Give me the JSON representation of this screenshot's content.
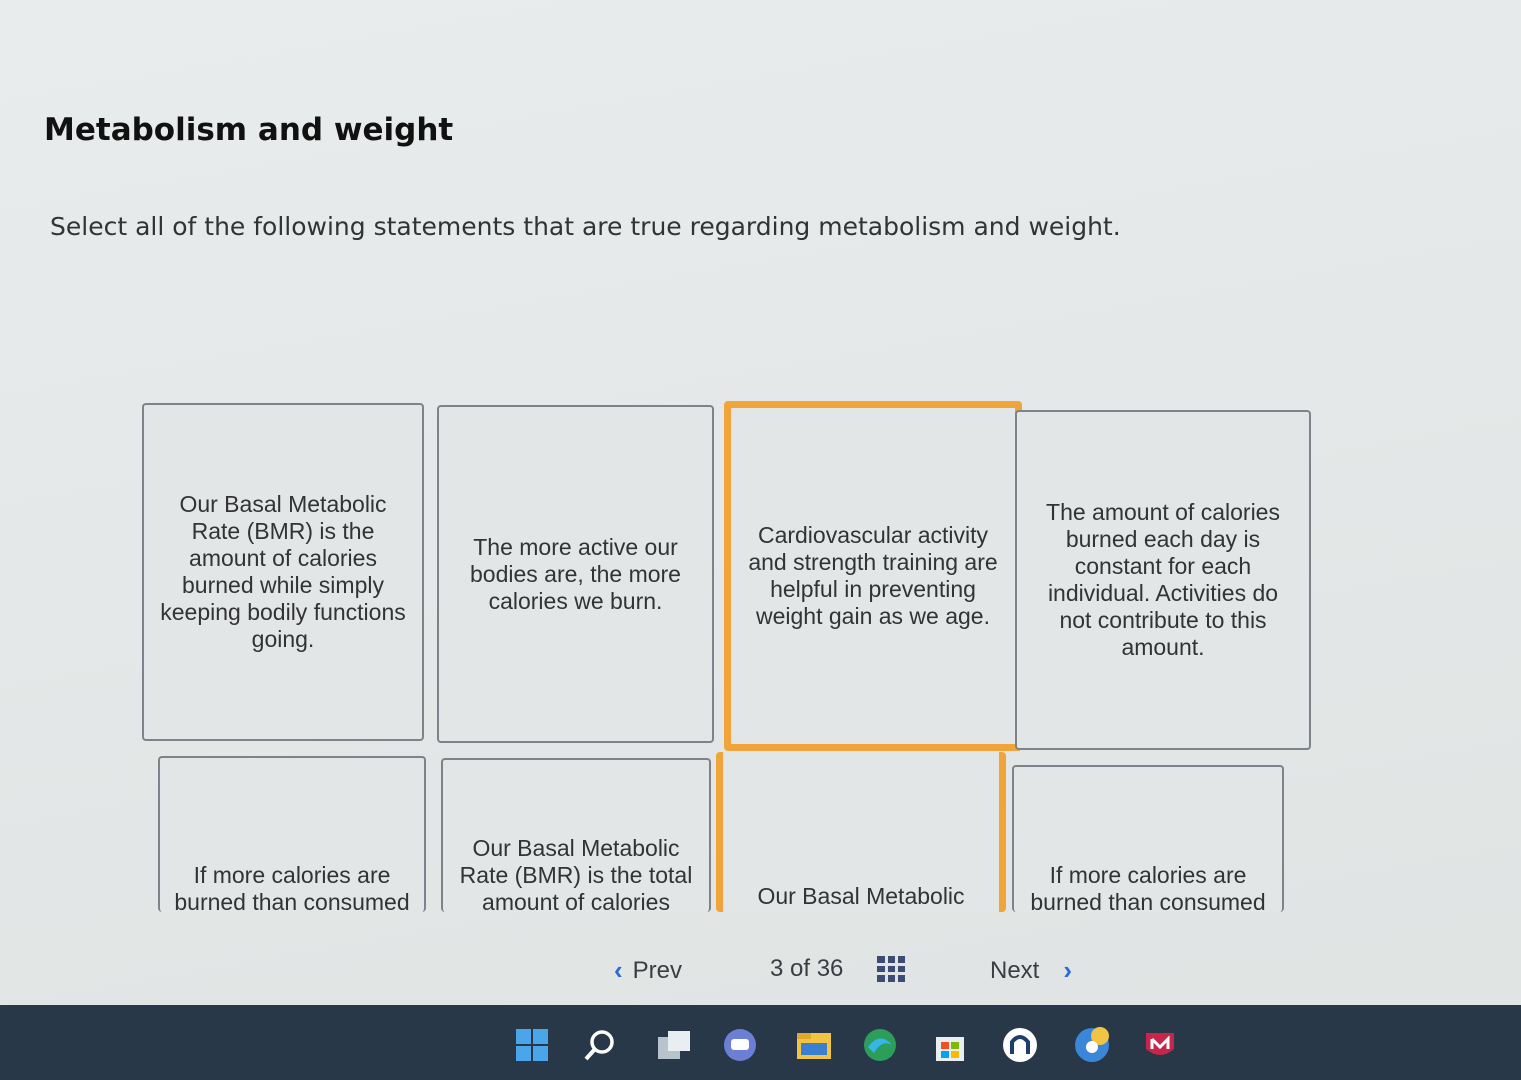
{
  "title": "Metabolism and weight",
  "prompt": "Select all of the following statements that are true regarding metabolism and weight.",
  "cards": [
    {
      "text": "Our Basal Metabolic Rate (BMR) is the amount of calories burned while simply keeping bodily functions going.",
      "selected": false
    },
    {
      "text": "The more active our bodies are, the more calories we burn.",
      "selected": false
    },
    {
      "text": "Cardiovascular activity and strength training are helpful in preventing weight gain as we age.",
      "selected": true
    },
    {
      "text": "The amount of calories burned each day is constant for each individual. Activities do not contribute to this amount.",
      "selected": false
    },
    {
      "text": "If more calories are burned than consumed",
      "selected": false
    },
    {
      "text": "Our Basal Metabolic Rate (BMR) is the total amount of calories",
      "selected": false
    },
    {
      "text": "Our Basal Metabolic",
      "selected": true
    },
    {
      "text": "If more calories are burned than consumed",
      "selected": false
    }
  ],
  "pager": {
    "prev": "Prev",
    "position": "3 of 36",
    "next": "Next"
  },
  "taskbar": {
    "icons": [
      "windows-start-icon",
      "search-icon",
      "task-view-icon",
      "chat-icon",
      "file-explorer-icon",
      "edge-browser-icon",
      "store-icon",
      "app-icon",
      "chrome-icon",
      "mcafee-icon"
    ]
  }
}
